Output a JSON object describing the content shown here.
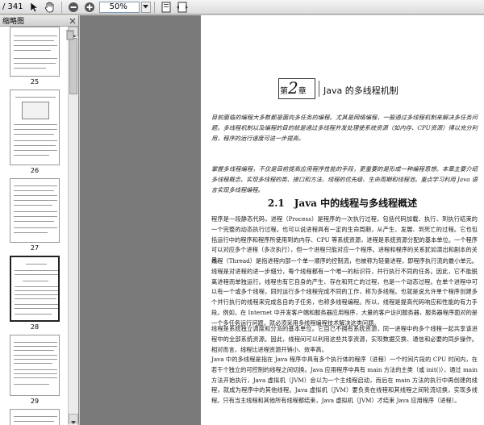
{
  "toolbar": {
    "page_count": "/ 341",
    "zoom_value": "50%"
  },
  "sidebar": {
    "title": "缩略图",
    "page_numbers": [
      "25",
      "26",
      "27",
      "28",
      "29"
    ]
  },
  "document": {
    "chapter_prefix": "第",
    "chapter_number": "2",
    "chapter_suffix": "章",
    "chapter_title": "Java 的多线程机制",
    "abstract": "目前面临的编程大多数都是面向多任务的编程。尤其是网络编程，一般通过多线程机制来解决多任务问题。多线程机制以及编程的目的就是通过多线程并发处理使系统资源（如内存、CPU资源）得以充分利用，程序的运行速度可进一步提高。",
    "keywords": "掌握多线程编程，不仅是目前提高应用程序性能的手段，更重要的是形成一种编程思想。本章主要介绍多线程概念、实现多线程的类、接口和方法、线程的优先级、生命周期和线程池。重点学习利用 Java 语言实现多线程编程。",
    "section_title": "2.1　Java 中的线程与多线程概述",
    "body1": "程序是一段静态代码，进程（Process）是程序的一次执行过程，包括代码加载、执行、到执行结束的一个完整的动态执行过程。也可以说进程具有一定的生命周期，从产生、发展、到死亡的过程。它也包括运行中的程序和程序所使用到的内存、CPU 等系统资源，进程是系统资源分配的基本单位。一个程序可以对应多个进程（多次执行），但一个进程只能对应一个程序。进程和程序的关系犹如演出和剧本的关系。",
    "body2": "线程（Thread）是指进程内部一个单一顺序的控制流，也被称为轻量进程，即程序执行流的最小单元。线程是对进程的进一步细分，每个线程都有一个唯一的标识符，并行执行不同的任务。因此，它不能脱离进程而单独运行。线程也有它自身的产生、存在和死亡的过程，也是一个动态过程。在单个进程中可以有一个或多个线程，同时运行多个线程完成不同的工作，称为多线程。也就是说允许单个程序创建多个并行执行的线程来完成各自的子任务，也称多线程编程。所以，线程是提高代码响应和性能的有力手段。例如，在 Internet 中开发客户端和服务器应用程序，大量的客户访问服务器，服务器程序面对的是一个多任务运行问题，就必须采用多线程编程技术解决这类问题。",
    "body3": "线程是系统独立调度和分派的基本单位。它自己不拥有系统资源，同一进程中的多个线程一起共享该进程中的全部系统资源。因此，线程间可以利用这些共享资源，实现数据交换、通信和必要的同步操作。相对而言，线程比进程资源开销小、效率高。",
    "body4": "Java 中的多线程是指在 Java 程序中具有多个执行体的程序（进程）一个时间片段的 CPU 时间内，在若干个独立的可控制的线程之间切换。Java 应用程序中具有 main 方法的主类（或 init()），通过 main 方法开始执行，Java 虚拟机（JVM）会以为一个主线程启动，而后在 main 方法的执行中再创建的线程，就成为程序中的其他线程。Java 虚拟机（JVM）要负责在线程和其线程之间轮流切换，实现多线程。只有当主线程和其他所有线程都结束，Java 虚拟机（JVM）才结束 Java 应用程序（进程）。"
  }
}
